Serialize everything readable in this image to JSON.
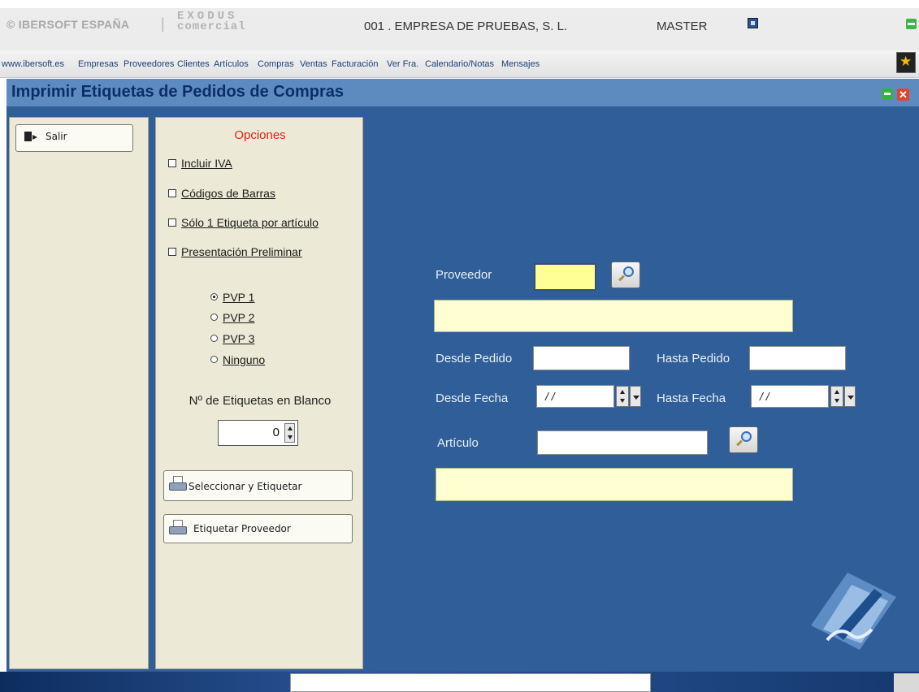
{
  "header": {
    "brand": "© IBERSOFT ESPAÑA",
    "separator": "|",
    "exodus_line1": "EXODUS",
    "exodus_line2": "comercial",
    "company": "001 . EMPRESA DE PRUEBAS, S. L.",
    "user": "MASTER"
  },
  "menu": {
    "items": [
      "www.ibersoft.es",
      "Empresas",
      "Proveedores",
      "Clientes",
      "Artículos",
      "Compras",
      "Ventas",
      "Facturación",
      "Ver Fra.",
      "Calendario/Notas",
      "Mensajes"
    ]
  },
  "window": {
    "title": "Imprimir Etiquetas de Pedidos de Compras",
    "close_glyph": "✕"
  },
  "left": {
    "exit_label": "Salir"
  },
  "options": {
    "title": "Opciones",
    "checkboxes": [
      {
        "label": "Incluir IVA",
        "checked": false
      },
      {
        "label": "Códigos de Barras",
        "checked": false
      },
      {
        "label": "Sólo 1 Etiqueta por artículo",
        "checked": false
      },
      {
        "label": "Presentación Preliminar",
        "checked": false
      }
    ],
    "radios": [
      {
        "label": "PVP 1",
        "selected": true
      },
      {
        "label": "PVP 2",
        "selected": false
      },
      {
        "label": "PVP 3",
        "selected": false
      },
      {
        "label": "Ninguno",
        "selected": false
      }
    ],
    "blank_labels_title": "Nº de Etiquetas en Blanco",
    "blank_labels_value": "0",
    "select_and_label_button": "Seleccionar y Etiquetar",
    "label_supplier_button": "Etiquetar Proveedor"
  },
  "form": {
    "proveedor_label": "Proveedor",
    "proveedor_value": "",
    "proveedor_name": "",
    "desde_pedido_label": "Desde Pedido",
    "desde_pedido_value": "",
    "hasta_pedido_label": "Hasta Pedido",
    "hasta_pedido_value": "",
    "desde_fecha_label": "Desde Fecha",
    "desde_fecha_value": "/ /",
    "hasta_fecha_label": "Hasta Fecha",
    "hasta_fecha_value": "/ /",
    "articulo_label": "Artículo",
    "articulo_value": "",
    "articulo_name": ""
  },
  "colors": {
    "title_bar": "#5d8bc0",
    "body": "#2f5e98",
    "panel": "#ecead6",
    "required_field": "#ffff96",
    "options_title": "#e0241a"
  },
  "icons": [
    "system-icon",
    "minimize-icon",
    "star-icon",
    "close-icon",
    "exit-icon",
    "printer-icon",
    "search-icon",
    "spinner-icon",
    "dropdown-icon",
    "pen-document-icon"
  ]
}
